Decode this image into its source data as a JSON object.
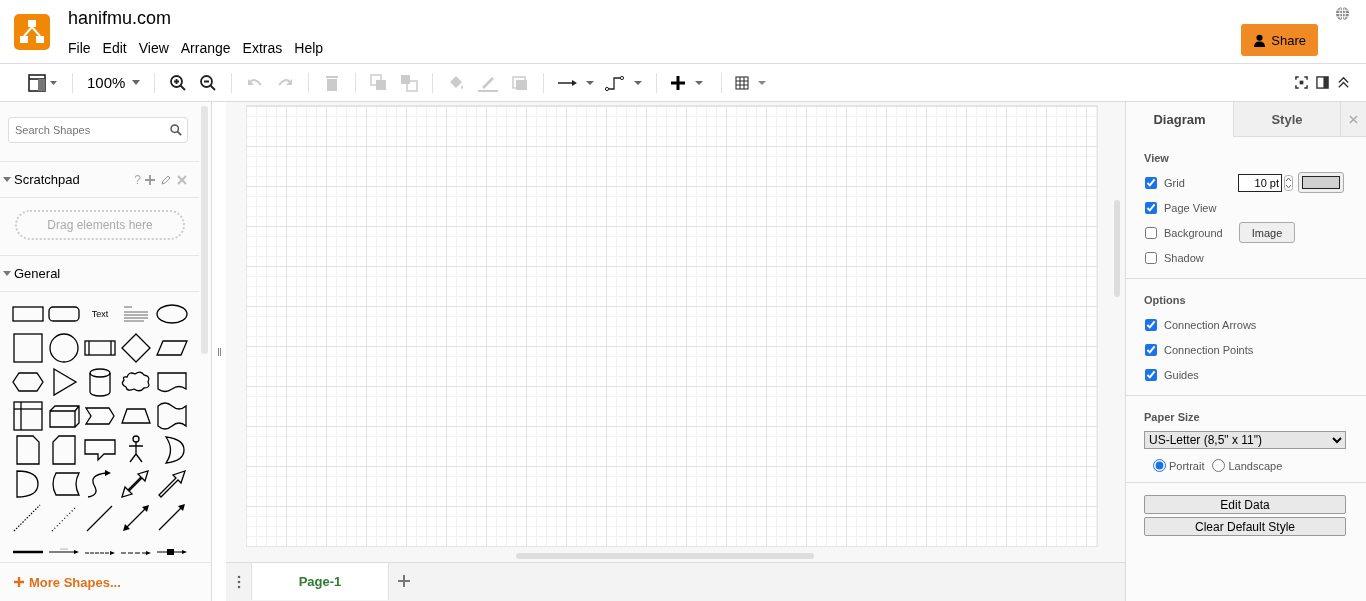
{
  "app": {
    "title": "hanifmu.com",
    "menu": [
      "File",
      "Edit",
      "View",
      "Arrange",
      "Extras",
      "Help"
    ],
    "share_button": "Share"
  },
  "toolbar": {
    "zoom": "100%"
  },
  "sidebar": {
    "search": {
      "placeholder": "Search Shapes"
    },
    "scratchpad": {
      "title": "Scratchpad",
      "help": "?",
      "expanded": true,
      "drop_hint": "Drag elements here"
    },
    "general": {
      "title": "General",
      "expanded": true,
      "text_shape": "Text"
    },
    "more_shapes": "More Shapes..."
  },
  "pages": [
    {
      "label": "Page-1",
      "selected": true
    }
  ],
  "panel": {
    "tabs": [
      {
        "label": "Diagram",
        "selected": true
      },
      {
        "label": "Style",
        "selected": false
      }
    ],
    "view": {
      "title": "View",
      "items": [
        {
          "kind": "grid",
          "label": "Grid",
          "checked": true,
          "value": "10 pt"
        },
        {
          "kind": "plain",
          "label": "Page View",
          "checked": true
        },
        {
          "kind": "background",
          "label": "Background",
          "checked": false,
          "button": "Image"
        },
        {
          "kind": "plain",
          "label": "Shadow",
          "checked": false
        }
      ]
    },
    "options": {
      "title": "Options",
      "items": [
        {
          "label": "Connection Arrows",
          "checked": true
        },
        {
          "label": "Connection Points",
          "checked": true
        },
        {
          "label": "Guides",
          "checked": true
        }
      ]
    },
    "paper": {
      "title": "Paper Size",
      "value": "US-Letter (8,5\" x 11\")",
      "orientations": [
        {
          "label": "Portrait",
          "selected": true
        },
        {
          "label": "Landscape",
          "selected": false
        }
      ]
    },
    "buttons": [
      "Edit Data",
      "Clear Default Style"
    ]
  }
}
